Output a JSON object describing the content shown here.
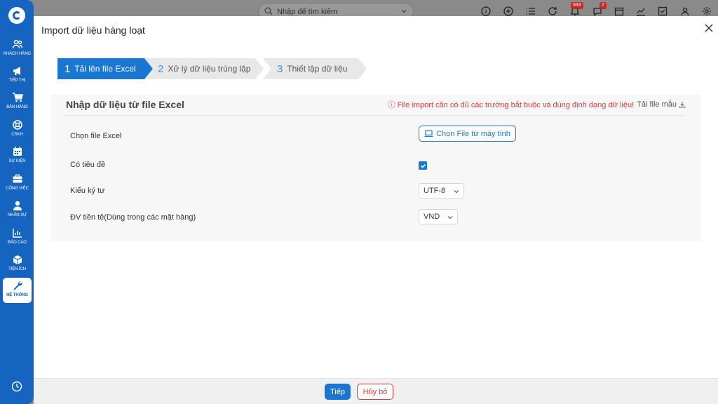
{
  "sidebar": {
    "items": [
      {
        "label": "KHÁCH HÀNG",
        "icon": "users-icon"
      },
      {
        "label": "TIẾP THỊ",
        "icon": "megaphone-icon"
      },
      {
        "label": "BÁN HÀNG",
        "icon": "cart-icon"
      },
      {
        "label": "CSKH",
        "icon": "lifebuoy-icon"
      },
      {
        "label": "SỰ KIỆN",
        "icon": "calendar-icon"
      },
      {
        "label": "CÔNG VIỆC",
        "icon": "briefcase-icon"
      },
      {
        "label": "NHÂN SỰ",
        "icon": "person-icon"
      },
      {
        "label": "BÁO CÁO",
        "icon": "report-icon"
      },
      {
        "label": "TIỆN ÍCH",
        "icon": "box-icon"
      },
      {
        "label": "HỆ THỐNG",
        "icon": "wrench-icon",
        "active": true
      }
    ]
  },
  "header": {
    "search_placeholder": "Nhập để tìm kiếm",
    "notification_count": "693",
    "chat_count": "2"
  },
  "modal": {
    "title": "Import dữ liệu hàng loạt",
    "steps": [
      {
        "num": "1",
        "label": "Tải lên file Excel"
      },
      {
        "num": "2",
        "label": "Xử lý dữ liệu trùng lặp"
      },
      {
        "num": "3",
        "label": "Thiết lập dữ liệu"
      }
    ],
    "panel": {
      "title": "Nhập dữ liệu từ file Excel",
      "note": "ⓘ File import cần có đủ các trường bắt buộc và đúng định dạng dữ liệu!",
      "download_label": "Tải file mẫu",
      "rows": {
        "file_label": "Chọn file Excel",
        "file_button": "Chọn File từ máy tính",
        "header_label": "Có tiêu đề",
        "header_checked": true,
        "charset_label": "Kiểu ký tự",
        "charset_value": "UTF-8",
        "currency_label": "ĐV tiền tệ(Dùng trong các mặt hàng)",
        "currency_value": "VND"
      }
    },
    "footer": {
      "next_label": "Tiếp",
      "cancel_label": "Hủy bỏ"
    }
  },
  "colors": {
    "primary": "#1976d2",
    "sidebar": "#1565c0",
    "danger": "#e53935"
  }
}
